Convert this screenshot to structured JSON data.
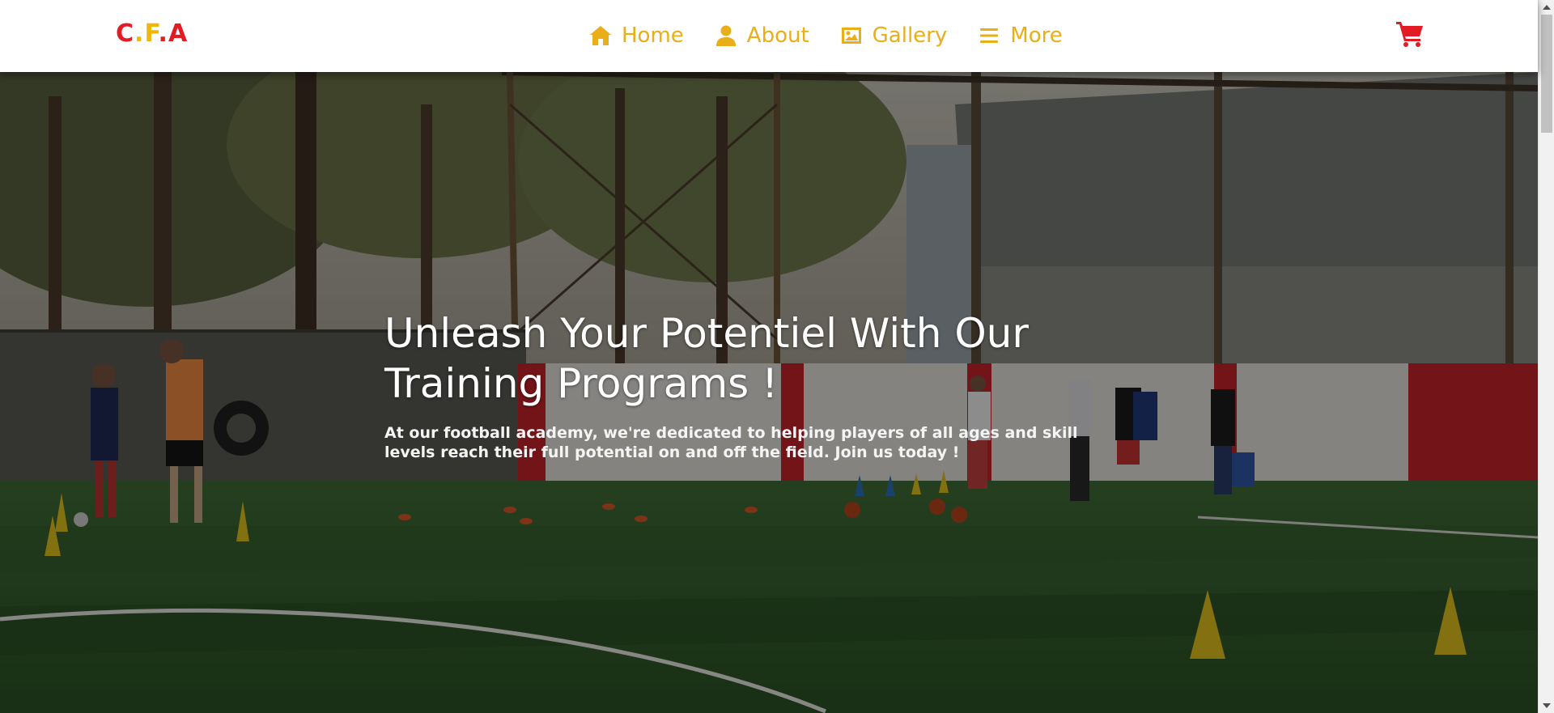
{
  "brand": {
    "c": "C",
    "dot1": ".",
    "f": "F",
    "dot2": ".",
    "a": "A"
  },
  "nav": [
    {
      "icon": "home-icon",
      "label": "Home"
    },
    {
      "icon": "user-icon",
      "label": "About"
    },
    {
      "icon": "image-icon",
      "label": "Gallery"
    },
    {
      "icon": "menu-icon",
      "label": "More"
    }
  ],
  "cart": {
    "icon": "shopping-cart-icon"
  },
  "hero": {
    "title_line1": "Unleash Your Potentiel With Our",
    "title_line2": "Training Programs !",
    "subtitle": "At our football academy, we're dedicated to helping players of all ages and skill levels reach their full potential on and off the field. Join us today !"
  },
  "colors": {
    "brand_red": "#e31b23",
    "brand_gold": "#f2b705",
    "nav_gold": "#e9ae18"
  }
}
